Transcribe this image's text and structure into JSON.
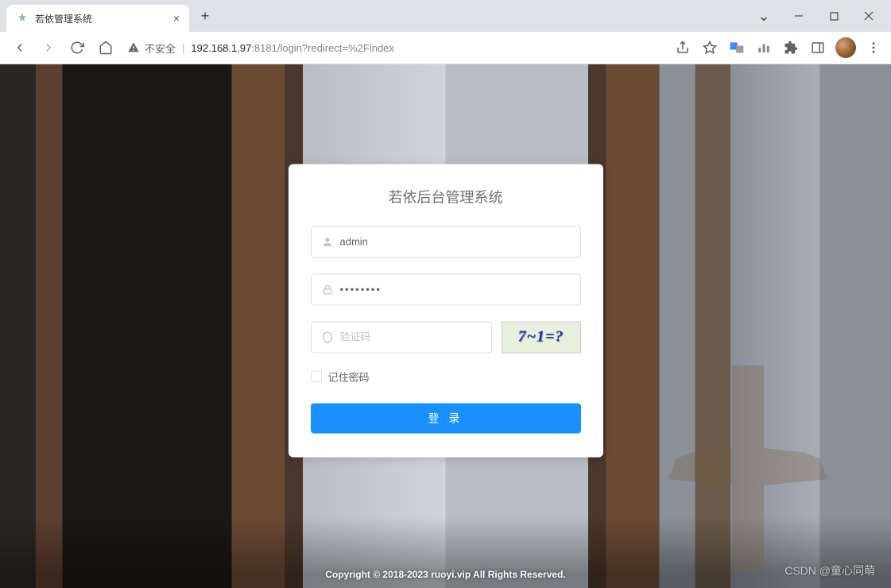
{
  "browser": {
    "tab_title": "若依管理系统",
    "insecure_label": "不安全",
    "url_host": "192.168.1.97",
    "url_port_path": ":8181/login?redirect=%2Findex"
  },
  "login": {
    "title": "若依后台管理系统",
    "username_value": "admin",
    "password_value": "••••••••",
    "captcha_placeholder": "验证码",
    "captcha_text": "7~1=?",
    "remember_label": "记住密码",
    "login_button": "登 录"
  },
  "footer": {
    "copyright": "Copyright © 2018-2023 ruoyi.vip All Rights Reserved."
  },
  "watermark": "CSDN @童心同萌"
}
